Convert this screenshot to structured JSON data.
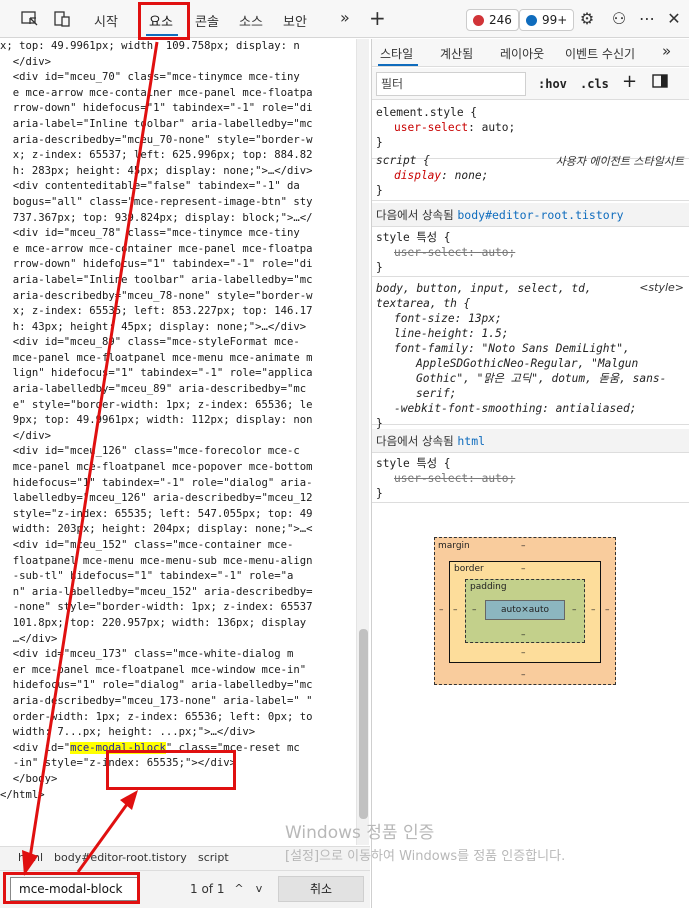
{
  "toolbar": {
    "tabs": [
      "시작",
      "요소",
      "콘솔",
      "소스",
      "보안"
    ],
    "errors": "246",
    "infos": "99+",
    "more_tabs": "»",
    "add": "+"
  },
  "code_lines": [
    "x; top: 49.9961px; width: 109.758px; display: n",
    "  </div>",
    "  <div id=\"mceu_70\" class=\"mce-tinymce mce-tiny",
    "  e mce-arrow mce-container mce-panel mce-floatpa",
    "  rrow-down\" hidefocus=\"1\" tabindex=\"-1\" role=\"di",
    "  aria-label=\"Inline toolbar\" aria-labelledby=\"mc",
    "  aria-describedby=\"mceu_70-none\" style=\"border-w",
    "  x; z-index: 65537; left: 625.996px; top: 884.82",
    "  h: 283px; height: 45px; display: none;\">…</div>",
    "  <div contenteditable=\"false\" tabindex=\"-1\" da",
    "  bogus=\"all\" class=\"mce-represent-image-btn\" sty",
    "  737.367px; top: 939.824px; display: block;\">…</",
    "  <div id=\"mceu_78\" class=\"mce-tinymce mce-tiny",
    "  e mce-arrow mce-container mce-panel mce-floatpa",
    "  rrow-down\" hidefocus=\"1\" tabindex=\"-1\" role=\"di",
    "  aria-label=\"Inline toolbar\" aria-labelledby=\"mc",
    "  aria-describedby=\"mceu_78-none\" style=\"border-w",
    "  x; z-index: 65535; left: 853.227px; top: 146.17",
    "  h: 43px; height: 45px; display: none;\">…</div>",
    "  <div id=\"mceu_89\" class=\"mce-styleFormat mce-",
    "  mce-panel mce-floatpanel mce-menu mce-animate m",
    "  lign\" hidefocus=\"1\" tabindex=\"-1\" role=\"applica",
    "  aria-labelledby=\"mceu_89\" aria-describedby=\"mc",
    "  e\" style=\"border-width: 1px; z-index: 65536; le",
    "  9px; top: 49.9961px; width: 112px; display: non",
    "  </div>",
    "  <div id=\"mceu_126\" class=\"mce-forecolor mce-c",
    "  mce-panel mce-floatpanel mce-popover mce-bottom",
    "  hidefocus=\"1\" tabindex=\"-1\" role=\"dialog\" aria-",
    "  labelledby=\"mceu_126\" aria-describedby=\"mceu_12",
    "  style=\"z-index: 65535; left: 547.055px; top: 49",
    "  width: 203px; height: 204px; display: none;\">…<",
    "  <div id=\"mceu_152\" class=\"mce-container mce-",
    "  floatpanel mce-menu mce-menu-sub mce-menu-align",
    "  -sub-tl\" hidefocus=\"1\" tabindex=\"-1\" role=\"a",
    "  n\" aria-labelledby=\"mceu_152\" aria-describedby=",
    "  -none\" style=\"border-width: 1px; z-index: 65537",
    "  101.8px; top: 220.957px; width: 136px; display",
    "  …</div>",
    "  <div id=\"mceu_173\" class=\"mce-white-dialog m",
    "  er mce-panel mce-floatpanel mce-window mce-in\"",
    "  hidefocus=\"1\" role=\"dialog\" aria-labelledby=\"mc",
    "  aria-describedby=\"mceu_173-none\" aria-label=\" \"",
    "  order-width: 1px; z-index: 65536; left: 0px; to",
    "  width: 7...px; height: ...px;\">…</div>",
    "  <div id=\"mce-modal-block\" class=\"mce-reset mc",
    "  -in\" style=\"z-index: 65535;\"></div>",
    "  </body>",
    "</html>"
  ],
  "highlight": "mce-modal-block",
  "breadcrumb": [
    "html",
    "body#editor-root.tistory",
    "script"
  ],
  "search": {
    "value": "mce-modal-block",
    "count": "1 of 1",
    "prev": "^",
    "next": "v",
    "cancel": "취소"
  },
  "styles_tabs": [
    "스타일",
    "계산됨",
    "레이아웃",
    "이벤트 수신기",
    "»"
  ],
  "filter": {
    "placeholder": "필터",
    "hov": ":hov",
    "cls": ".cls"
  },
  "rules": {
    "element_style": {
      "selector": "element.style {",
      "prop": "user-select",
      "value": "auto;"
    },
    "script_rule": {
      "selector": "script {",
      "origin": "사용자 에이전트 스타일시트",
      "prop": "display",
      "value": "none;"
    },
    "inherit1": {
      "label": "다음에서 상속됨",
      "link": "body#editor-root.tistory"
    },
    "style_attr1": {
      "selector": "style 특성 {",
      "prop": "user-select",
      "value": "auto;"
    },
    "body_rule": {
      "selector1": "body, button, input, select, td,",
      "selector2": "textarea, th {",
      "origin": "<style>",
      "font_size": "font-size: 13px;",
      "line_height": "line-height: 1.5;",
      "font_family1": "font-family: \"Noto Sans DemiLight\",",
      "font_family2": "AppleSDGothicNeo-Regular, \"Malgun",
      "font_family3": "Gothic\", \"맑은 고딕\", dotum, 돋움, sans-",
      "font_family4": "serif;",
      "smoothing": "-webkit-font-smoothing: antialiased;"
    },
    "inherit2": {
      "label": "다음에서 상속됨",
      "link": "html"
    },
    "style_attr2": {
      "selector": "style 특성 {",
      "prop": "user-select",
      "value": "auto;"
    },
    "close": "}"
  },
  "box_model": {
    "margin": "margin",
    "border": "border",
    "padding": "padding",
    "content": "auto×auto",
    "dash": "–"
  },
  "watermark": {
    "line1": "Windows 정품 인증",
    "line2": "[설정]으로 이동하여 Windows를 정품 인증합니다."
  }
}
